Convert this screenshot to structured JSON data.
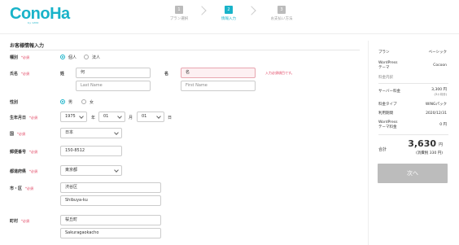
{
  "header": {
    "logo": "ConoHa",
    "logo_sub": "by GMO",
    "steps": [
      {
        "num": "1",
        "label": "プラン選択"
      },
      {
        "num": "2",
        "label": "情報入力"
      },
      {
        "num": "3",
        "label": "お支払い方法"
      }
    ]
  },
  "form": {
    "title": "お客様情報入力",
    "required": "*必須",
    "type": {
      "label": "種別",
      "opt1": "個人",
      "opt2": "法人"
    },
    "name": {
      "label": "氏名",
      "sei_label": "姓",
      "mei_label": "名",
      "sei_value": "何",
      "mei_value": "名",
      "last_ph": "Last Name",
      "first_ph": "First Name",
      "error": "入力必須項目です。"
    },
    "gender": {
      "label": "性別",
      "opt1": "男",
      "opt2": "女"
    },
    "birth": {
      "label": "生年月日",
      "year": "1975",
      "month": "01",
      "day": "01",
      "year_unit": "年",
      "month_unit": "月",
      "day_unit": "日"
    },
    "country": {
      "label": "国",
      "value": "日本"
    },
    "zip": {
      "label": "郵便番号",
      "value": "150-8512"
    },
    "pref": {
      "label": "都道府県",
      "value": "東京都"
    },
    "city": {
      "label": "市・区",
      "value": "渋谷区",
      "value_en": "Shibuya-ku"
    },
    "town": {
      "label": "町村",
      "value": "桜丘町",
      "value_en": "Sakuragaokacho"
    }
  },
  "summary": {
    "plan_k": "プラン",
    "plan_v": "ベーシック",
    "theme_k": "WordPress\nテーマ",
    "theme_v": "Cocoon",
    "fee_detail": "料金内訳",
    "server_k": "サーバー料金",
    "server_v": "3,300 円",
    "server_note": "(3ヶ月分)",
    "type_k": "料金タイプ",
    "type_v": "WINGパック",
    "period_k": "利用期間",
    "period_v": "2020/12/31",
    "theme_fee_k": "WordPress\nテーマ料金",
    "theme_fee_v": "0 円",
    "total_k": "合計",
    "total_v": "3,630",
    "total_yen": "円",
    "total_tax": "(消費税 330 円)",
    "next_button": "次へ"
  }
}
